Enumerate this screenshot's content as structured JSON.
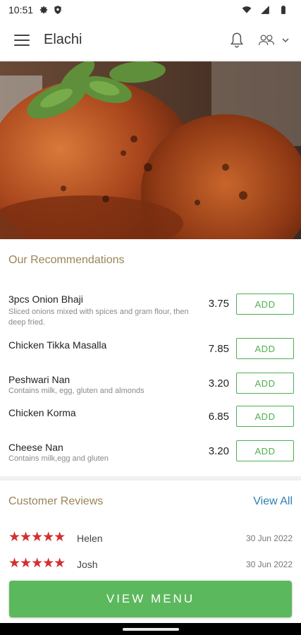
{
  "status_bar": {
    "time": "10:51",
    "icons": [
      "gear-icon",
      "shield-icon",
      "wifi-icon",
      "signal-icon",
      "battery-icon"
    ]
  },
  "app_bar": {
    "title": "Elachi",
    "icons": [
      "menu-icon",
      "bell-icon",
      "users-icon",
      "chevron-down-icon"
    ]
  },
  "hero": {
    "image": "tandoori-chicken-photo"
  },
  "recommendations": {
    "title": "Our Recommendations",
    "add_label": "ADD",
    "items": [
      {
        "name": "3pcs Onion Bhaji",
        "description": "Sliced onions mixed with spices and gram flour, then deep fried.",
        "price": "3.75"
      },
      {
        "name": "Chicken Tikka Masalla",
        "description": "",
        "price": "7.85"
      },
      {
        "name": "Peshwari Nan",
        "description": "Contains milk, egg, gluten and almonds",
        "price": "3.20"
      },
      {
        "name": "Chicken Korma",
        "description": "",
        "price": "6.85"
      },
      {
        "name": "Cheese Nan",
        "description": "Contains milk,egg and gluten",
        "price": "3.20"
      }
    ]
  },
  "reviews": {
    "title": "Customer Reviews",
    "view_all": "View All",
    "items": [
      {
        "stars": "★★★★★",
        "rating": 5,
        "name": "Helen",
        "date": "30 Jun 2022"
      },
      {
        "stars": "★★★★★",
        "rating": 5,
        "name": "Josh",
        "date": "30 Jun 2022"
      }
    ]
  },
  "cta": {
    "label": "VIEW MENU"
  },
  "colors": {
    "accent_green": "#4caf50",
    "cta_green": "#5cb85c",
    "section_title": "#9a8458",
    "link_blue": "#2d7fb8",
    "star_red": "#d32f2f"
  }
}
